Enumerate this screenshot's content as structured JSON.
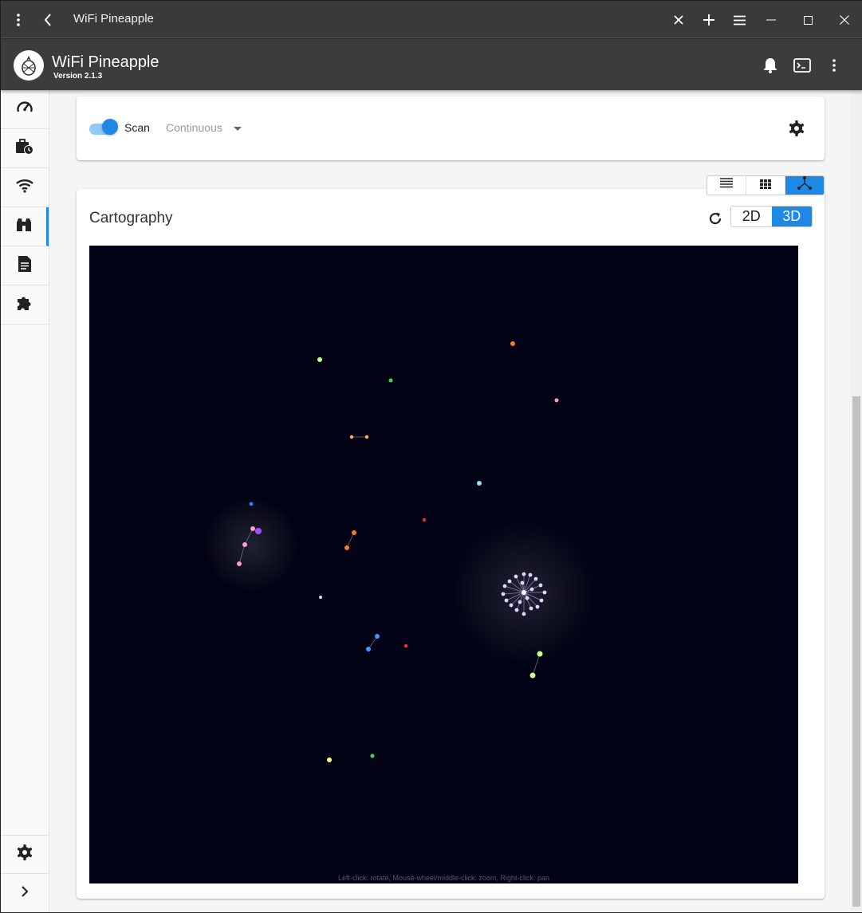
{
  "window": {
    "title": "WiFi Pineapple",
    "icons": [
      "more-vert-icon",
      "back-icon",
      "close-tab-icon",
      "add-tab-icon",
      "menu-icon",
      "minimize-icon",
      "maximize-icon",
      "close-window-icon"
    ]
  },
  "appbar": {
    "title": "WiFi Pineapple",
    "version": "Version 2.1.3",
    "icons": [
      "notifications-icon",
      "terminal-icon",
      "more-vert-icon"
    ]
  },
  "sidebar": {
    "items": [
      {
        "name": "dashboard",
        "icon": "speedometer-icon"
      },
      {
        "name": "campaigns",
        "icon": "briefcase-clock-icon"
      },
      {
        "name": "pineap",
        "icon": "wifi-icon"
      },
      {
        "name": "recon",
        "icon": "binoculars-icon",
        "active": true
      },
      {
        "name": "reports",
        "icon": "document-icon"
      },
      {
        "name": "modules",
        "icon": "puzzle-icon"
      }
    ],
    "bottom": [
      {
        "name": "settings",
        "icon": "gear-icon"
      },
      {
        "name": "expand",
        "icon": "chevron-right-icon"
      }
    ]
  },
  "scan": {
    "toggle_on": true,
    "label": "Scan",
    "mode": "Continuous"
  },
  "view_toggle": {
    "options": [
      "list-view",
      "grid-view",
      "graph-view"
    ],
    "active": "graph-view"
  },
  "cartography": {
    "title": "Cartography",
    "dim_options": [
      "2D",
      "3D"
    ],
    "dim_active": "3D",
    "hint": "Left-click: rotate, Mouse-wheel/middle-click: zoom, Right-click: pan"
  },
  "colors": {
    "accent": "#1e88e5",
    "graph_bg": "#020314",
    "appbar": "#3c3c3c"
  }
}
